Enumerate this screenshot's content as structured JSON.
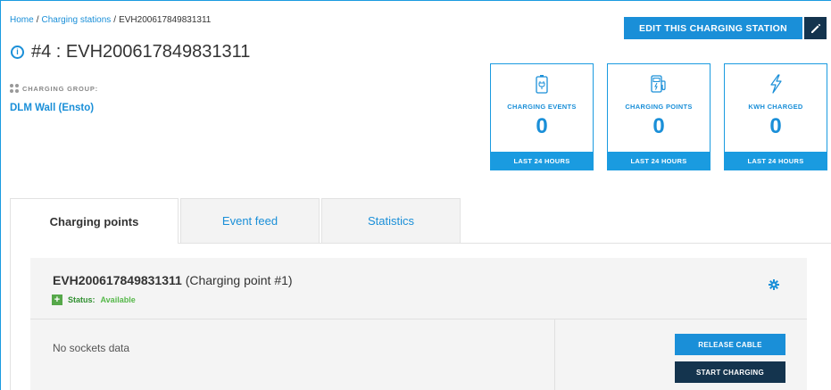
{
  "breadcrumb": {
    "home": "Home",
    "stations": "Charging stations",
    "current": "EVH200617849831311",
    "separator": "/"
  },
  "header": {
    "edit_label": "EDIT THIS CHARGING STATION",
    "title": "#4 : EVH200617849831311",
    "info_icon": "i"
  },
  "group": {
    "label": "CHARGING GROUP:",
    "value": "DLM Wall (Ensto)"
  },
  "stats": [
    {
      "label": "CHARGING EVENTS",
      "value": "0",
      "footer": "LAST 24 HOURS",
      "icon": "battery-charging-icon"
    },
    {
      "label": "CHARGING POINTS",
      "value": "0",
      "footer": "LAST 24 HOURS",
      "icon": "charging-station-icon"
    },
    {
      "label": "KWH CHARGED",
      "value": "0",
      "footer": "LAST 24 HOURS",
      "icon": "lightning-icon"
    }
  ],
  "tabs": [
    {
      "label": "Charging points"
    },
    {
      "label": "Event feed"
    },
    {
      "label": "Statistics"
    }
  ],
  "charging_point": {
    "id": "EVH200617849831311",
    "suffix": "(Charging point #1)",
    "status_key": "Status:",
    "status_value": "Available",
    "status_icon": "+",
    "no_sockets": "No sockets data",
    "release_label": "RELEASE CABLE",
    "start_label": "START CHARGING"
  },
  "colors": {
    "accent": "#1a8fd8",
    "dark": "#14344e",
    "success": "#56a84a"
  }
}
